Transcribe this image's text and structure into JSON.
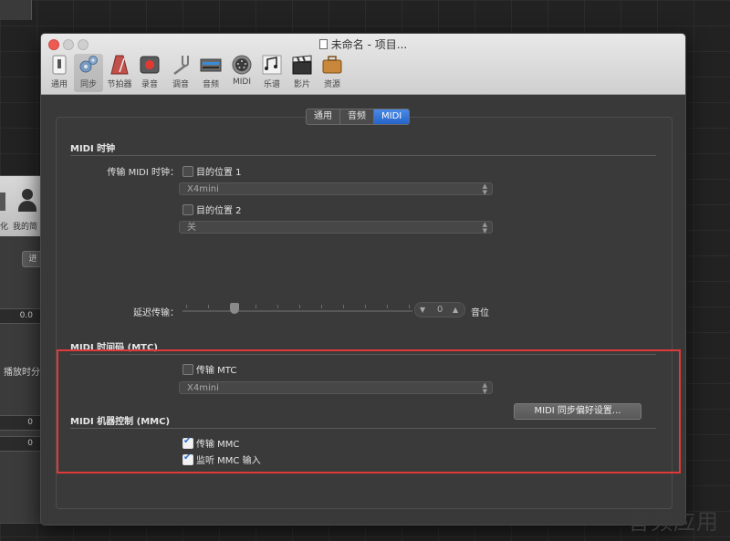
{
  "window": {
    "title": "未命名 - 项目..."
  },
  "toolbar": {
    "items": [
      {
        "label": "通用",
        "icon": "switch-icon"
      },
      {
        "label": "同步",
        "icon": "gears-icon"
      },
      {
        "label": "节拍器",
        "icon": "metronome-icon"
      },
      {
        "label": "录音",
        "icon": "record-icon"
      },
      {
        "label": "调音",
        "icon": "tuning-fork-icon"
      },
      {
        "label": "音频",
        "icon": "audio-interface-icon"
      },
      {
        "label": "MIDI",
        "icon": "midi-port-icon"
      },
      {
        "label": "乐谱",
        "icon": "score-icon"
      },
      {
        "label": "影片",
        "icon": "clapperboard-icon"
      },
      {
        "label": "资源",
        "icon": "briefcase-icon"
      }
    ],
    "selected": "同步"
  },
  "tabs": {
    "items": [
      "通用",
      "音频",
      "MIDI"
    ],
    "selected": "MIDI"
  },
  "midi_clock": {
    "title": "MIDI 时钟",
    "transmit_label": "传输 MIDI 时钟：",
    "dest1_label": "目的位置 1",
    "dest1_value": "X4mini",
    "dest2_label": "目的位置 2",
    "dest2_value": "关",
    "delay_label": "延迟传输：",
    "delay_value": "0",
    "delay_unit": "音位"
  },
  "mtc": {
    "title": "MIDI 时间码 (MTC)",
    "transmit_label": "传输 MTC",
    "dest_value": "X4mini"
  },
  "mmc": {
    "title": "MIDI 机器控制 (MMC)",
    "transmit_label": "传输 MMC",
    "listen_label": "监听 MMC 输入",
    "button_label": "MIDI 同步偏好设置..."
  },
  "behind_window": {
    "label1": "化",
    "label2": "我的简",
    "btn": "进",
    "field1": "0.0",
    "text": "播放时分",
    "field2": "0",
    "field3": "0"
  },
  "watermark": "音频应用",
  "colors": {
    "accent": "#2563c8",
    "highlight_box": "#e0393b"
  }
}
